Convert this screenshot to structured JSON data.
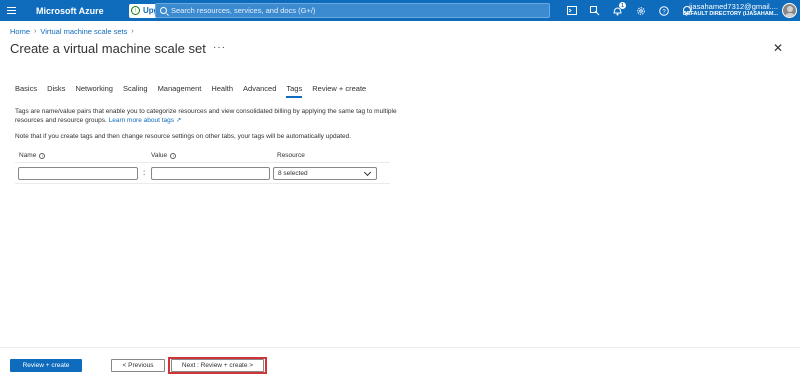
{
  "topbar": {
    "brand": "Microsoft Azure",
    "upgrade_label": "Upgrade",
    "search_placeholder": "Search resources, services, and docs (G+/)",
    "notification_count": "1",
    "user_name": "ijasahamed7312@gmail....",
    "user_directory": "DEFAULT DIRECTORY (IJASAHAM..."
  },
  "breadcrumb": [
    {
      "label": "Home"
    },
    {
      "label": "Virtual machine scale sets"
    }
  ],
  "page": {
    "title": "Create a virtual machine scale set",
    "more": "···",
    "close": "✕"
  },
  "tabs": [
    {
      "label": "Basics"
    },
    {
      "label": "Disks"
    },
    {
      "label": "Networking"
    },
    {
      "label": "Scaling"
    },
    {
      "label": "Management"
    },
    {
      "label": "Health"
    },
    {
      "label": "Advanced"
    },
    {
      "label": "Tags",
      "active": true
    },
    {
      "label": "Review + create"
    }
  ],
  "content": {
    "description": "Tags are name/value pairs that enable you to categorize resources and view consolidated billing by applying the same tag to multiple resources and resource groups.",
    "learn_more": "Learn more about tags",
    "note": "Note that if you create tags and then change resource settings on other tabs, your tags will be automatically updated."
  },
  "table": {
    "headers": {
      "name": "Name",
      "value": "Value",
      "resource": "Resource"
    },
    "row": {
      "name": "",
      "value": "",
      "resource": "8 selected"
    },
    "separator": ":"
  },
  "footer": {
    "review_create": "Review + create",
    "previous": "< Previous",
    "next": "Next : Review + create >"
  },
  "colors": {
    "brand": "#0f6cbd",
    "highlight_border": "#d13438"
  }
}
